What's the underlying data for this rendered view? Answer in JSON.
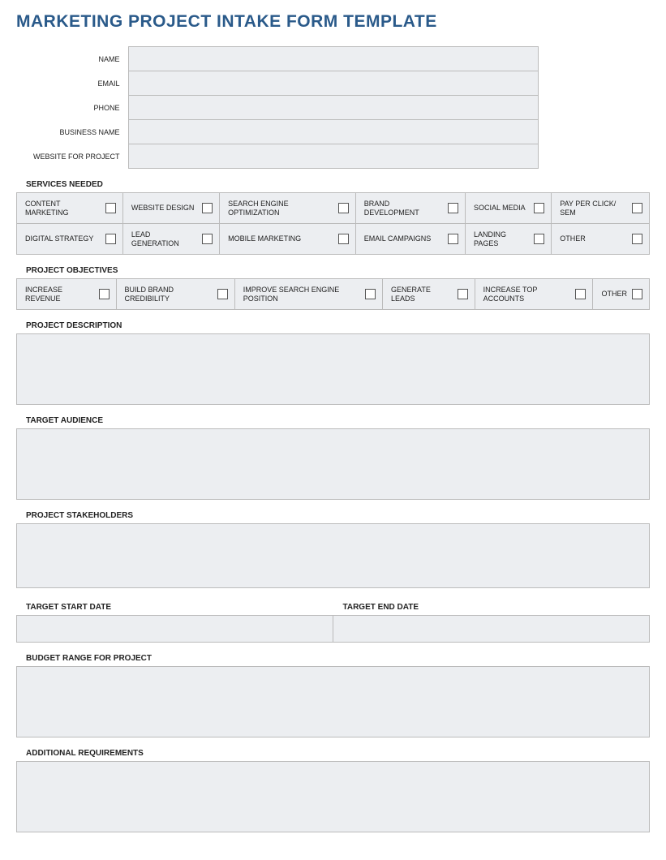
{
  "title": "MARKETING PROJECT INTAKE FORM TEMPLATE",
  "contact": {
    "name_label": "NAME",
    "email_label": "EMAIL",
    "phone_label": "PHONE",
    "business_label": "BUSINESS NAME",
    "website_label": "WEBSITE FOR PROJECT"
  },
  "services": {
    "title": "SERVICES NEEDED",
    "items": [
      "CONTENT MARKETING",
      "WEBSITE DESIGN",
      "SEARCH ENGINE OPTIMIZATION",
      "BRAND DEVELOPMENT",
      "SOCIAL MEDIA",
      "PAY PER CLICK/ SEM",
      "DIGITAL STRATEGY",
      "LEAD GENERATION",
      "MOBILE MARKETING",
      "EMAIL CAMPAIGNS",
      "LANDING PAGES",
      "OTHER"
    ]
  },
  "objectives": {
    "title": "PROJECT OBJECTIVES",
    "items": [
      "INCREASE REVENUE",
      "BUILD BRAND CREDIBILITY",
      "IMPROVE SEARCH ENGINE POSITION",
      "GENERATE LEADS",
      "INCREASE TOP ACCOUNTS",
      "OTHER"
    ]
  },
  "sections": {
    "description": "PROJECT DESCRIPTION",
    "audience": "TARGET AUDIENCE",
    "stakeholders": "PROJECT STAKEHOLDERS",
    "start_date": "TARGET START DATE",
    "end_date": "TARGET END DATE",
    "budget": "BUDGET RANGE FOR PROJECT",
    "additional": "ADDITIONAL REQUIREMENTS"
  }
}
